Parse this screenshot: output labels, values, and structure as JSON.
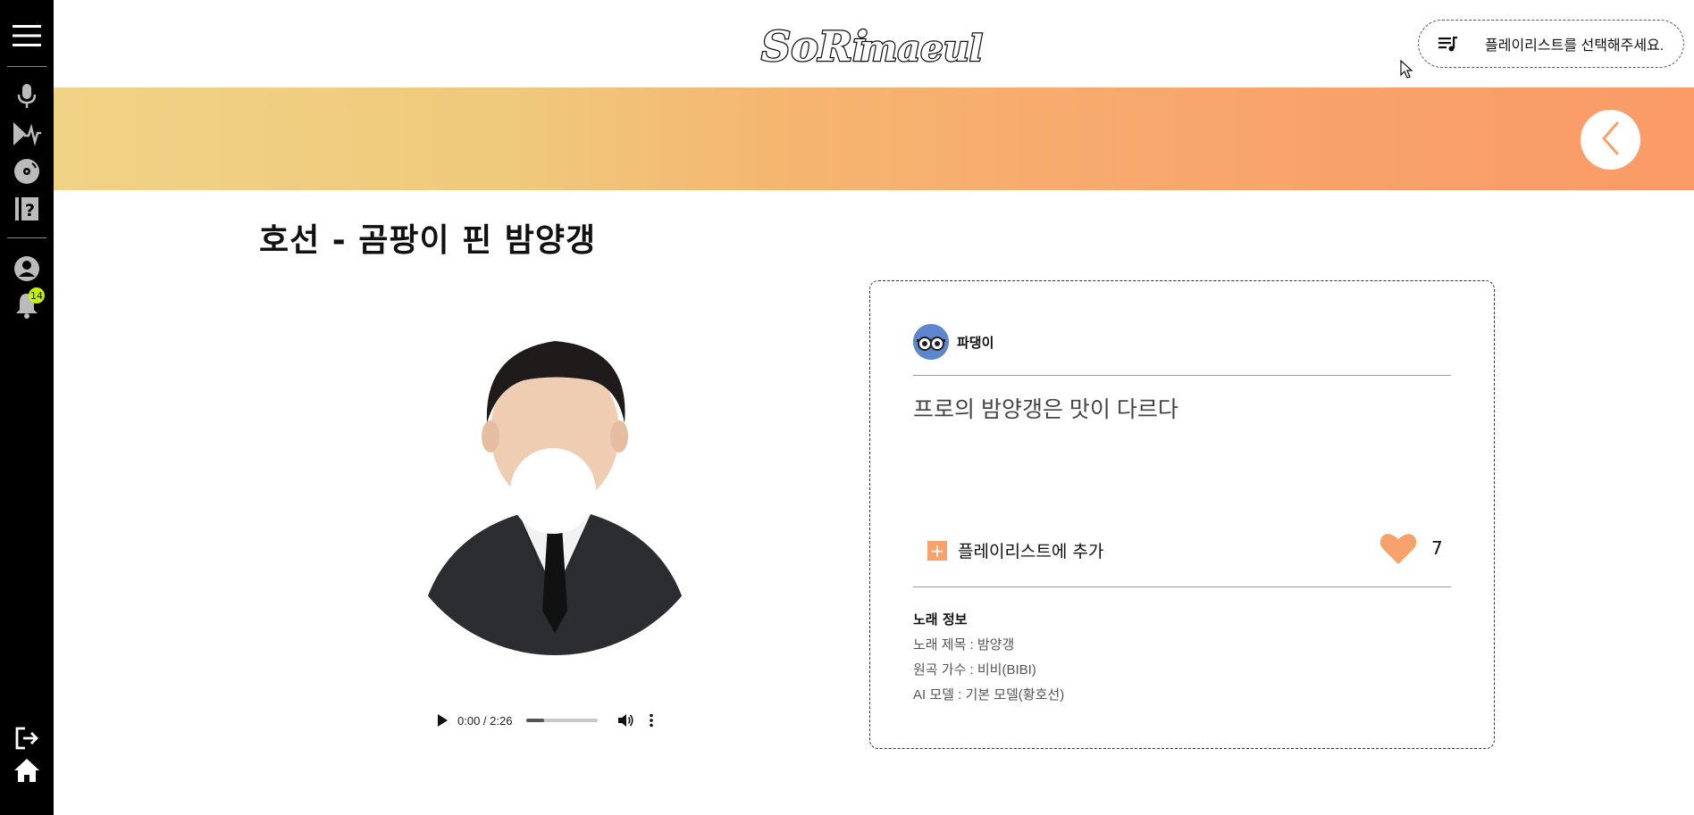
{
  "header": {
    "logo_text": "SoRimaeul",
    "playlist_prompt": "플레이리스트를 선택해주세요."
  },
  "sidebar": {
    "items": [
      {
        "name": "menu-icon"
      },
      {
        "name": "microphone-icon"
      },
      {
        "name": "music-wave-icon"
      },
      {
        "name": "disc-icon"
      },
      {
        "name": "help-book-icon"
      },
      {
        "name": "profile-icon"
      },
      {
        "name": "bell-icon"
      },
      {
        "name": "logout-icon"
      },
      {
        "name": "home-icon"
      }
    ],
    "notification_count": "14"
  },
  "song": {
    "title": "호선 - 곰팡이 핀 밤양갱"
  },
  "player": {
    "time": "0:00 / 2:26",
    "progress_fraction": 0.25
  },
  "card": {
    "author": "파댕이",
    "description": "프로의 밤양갱은 맛이 다르다",
    "add_playlist_label": "플레이리스트에 추가",
    "like_count": "7",
    "info_heading": "노래 정보",
    "info_lines": [
      "노래 제목 : 밤양갱",
      "원곡 가수 : 비비(BIBI)",
      "AI 모델 : 기본 모델(황호선)"
    ]
  },
  "colors": {
    "accent": "#f7a26a",
    "badge": "#c6f00c",
    "sidebar_bg": "#000000"
  }
}
